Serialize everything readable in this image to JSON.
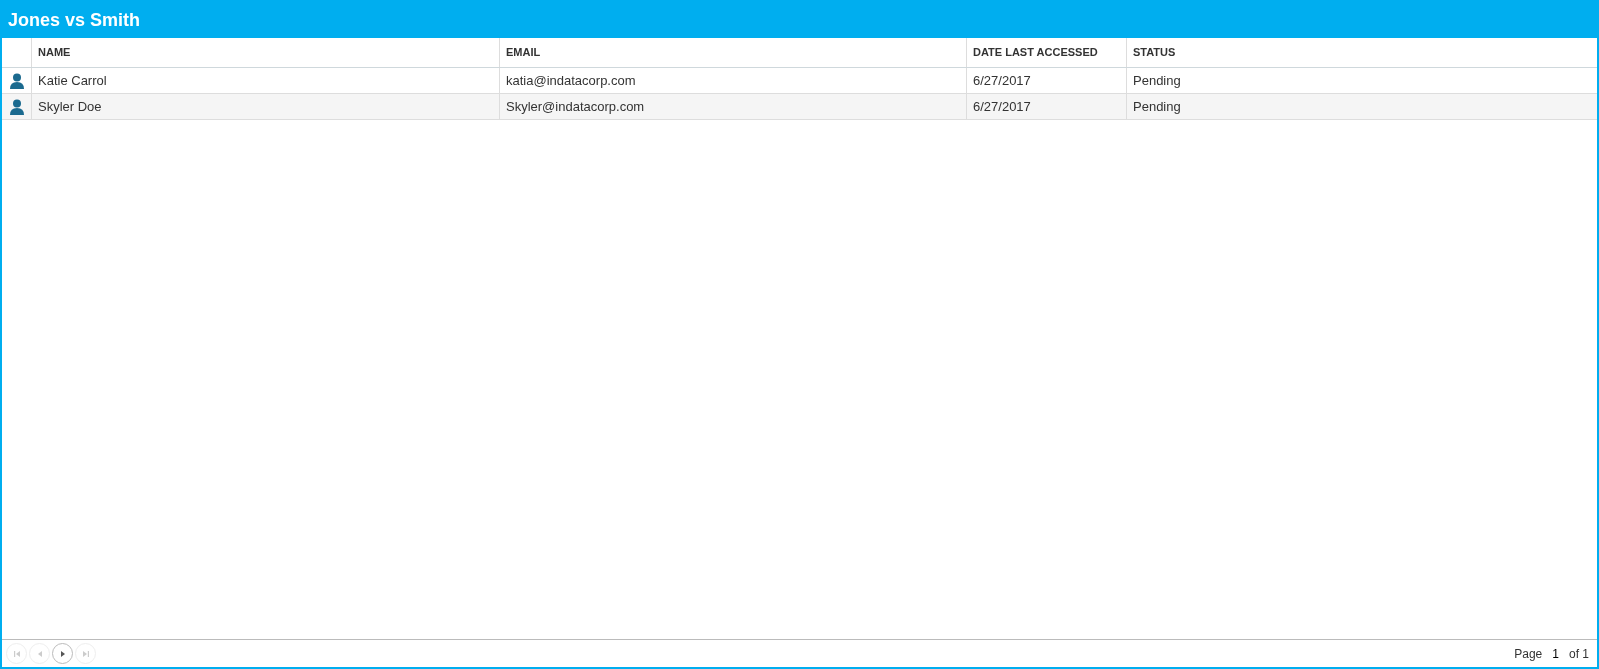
{
  "window": {
    "title": "Jones vs Smith"
  },
  "table": {
    "columns": [
      "NAME",
      "EMAIL",
      "DATE LAST ACCESSED",
      "STATUS"
    ],
    "rows": [
      {
        "selected": false,
        "cells": [
          "Katie Carrol",
          "katia@indatacorp.com",
          "6/27/2017",
          "Pending"
        ]
      },
      {
        "selected": false,
        "cells": [
          "Skyler Doe",
          "Skyler@indatacorp.com",
          "6/27/2017",
          "Pending"
        ]
      }
    ]
  },
  "pager": {
    "buttons": [
      {
        "kind": "first",
        "disabled": true
      },
      {
        "kind": "prev",
        "disabled": true
      },
      {
        "kind": "next",
        "disabled": false
      },
      {
        "kind": "last",
        "disabled": true
      }
    ],
    "page_label": "Page",
    "page": "1",
    "of_label": "of 1"
  }
}
